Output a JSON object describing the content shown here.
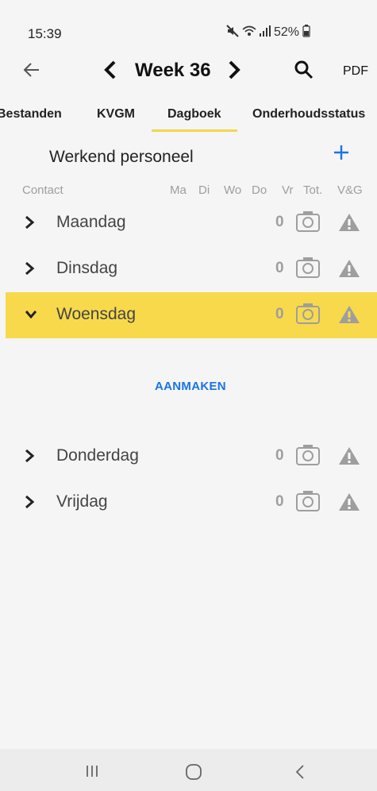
{
  "status_bar": {
    "time": "15:39",
    "battery": "52%"
  },
  "header": {
    "week_label": "Week 36",
    "pdf_label": "PDF"
  },
  "tabs": [
    {
      "label": "Bestanden"
    },
    {
      "label": "KVGM"
    },
    {
      "label": "Dagboek",
      "active": true
    },
    {
      "label": "Onderhoudsstatus"
    }
  ],
  "section": {
    "title": "Werkend personeel"
  },
  "columns": {
    "contact": "Contact",
    "ma": "Ma",
    "di": "Di",
    "wo": "Wo",
    "do": "Do",
    "vr": "Vr",
    "tot": "Tot.",
    "vg": "V&G"
  },
  "days": [
    {
      "label": "Maandag",
      "count": "0"
    },
    {
      "label": "Dinsdag",
      "count": "0"
    },
    {
      "label": "Woensdag",
      "count": "0",
      "expanded": true
    },
    {
      "label": "Donderdag",
      "count": "0"
    },
    {
      "label": "Vrijdag",
      "count": "0"
    }
  ],
  "create_button": "AANMAKEN",
  "colors": {
    "accent_yellow": "#f8d94c",
    "link_blue": "#1a73e8"
  }
}
